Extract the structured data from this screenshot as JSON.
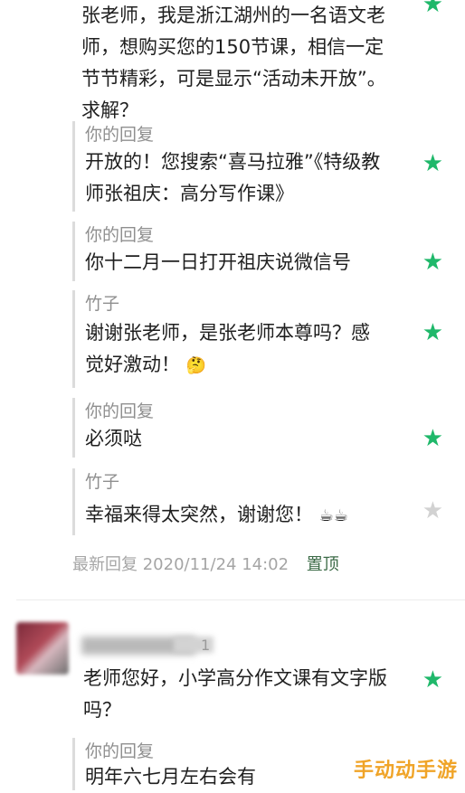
{
  "thread": [
    {
      "kind": "comment",
      "author": "",
      "text": "张老师，我是浙江湖州的一名语文老师，想购买您的150节课，相信一定节节精彩，可是显示“活动未开放”。求解？",
      "starred": true
    },
    {
      "kind": "reply",
      "author": "你的回复",
      "text": "开放的！您搜索“喜马拉雅”《特级教师张祖庆：高分写作课》",
      "starred": true
    },
    {
      "kind": "reply",
      "author": "你的回复",
      "text": "你十二月一日打开祖庆说微信号",
      "starred": true
    },
    {
      "kind": "reply",
      "author": "竹子",
      "text": "谢谢张老师，是张老师本尊吗？感觉好激动！",
      "emoji": "🤔",
      "starred": true
    },
    {
      "kind": "reply",
      "author": "你的回复",
      "text": "必须哒",
      "starred": true
    },
    {
      "kind": "reply",
      "author": "竹子",
      "text": "幸福来得太突然，谢谢您！",
      "emoji": "☕☕",
      "starred": false
    }
  ],
  "footer": {
    "latest": "最新回复 2020/11/24 14:02",
    "pin": "置顶"
  },
  "comment2": {
    "count": "1",
    "text": "老师您好，小学高分作文课有文字版吗？",
    "starred": true
  },
  "reply2": {
    "author": "你的回复",
    "text": "明年六七月左右会有",
    "starred": true
  },
  "icons": {
    "star": "star-icon"
  },
  "colors": {
    "star_green": "#1fb86a",
    "star_grey": "#d2d2d2",
    "pin": "#3c6b47"
  },
  "watermark": "手动动手游"
}
